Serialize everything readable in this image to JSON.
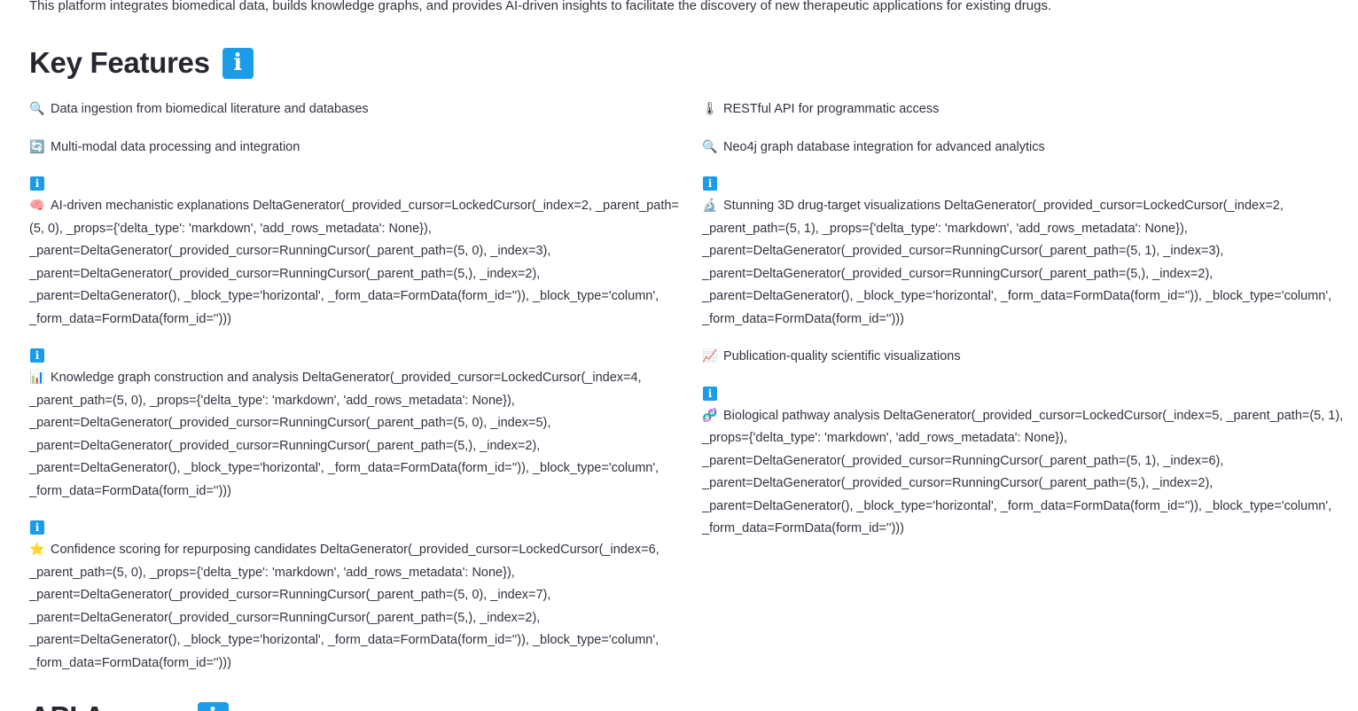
{
  "intro": "This platform integrates biomedical data, builds knowledge graphs, and provides AI-driven insights to facilitate the discovery of new therapeutic applications for existing drugs.",
  "key_features": {
    "title": "Key Features",
    "title_icon": "info-icon",
    "left": [
      {
        "emoji": "🔍",
        "icon": "magnifier-icon",
        "text": "Data ingestion from biomedical literature and databases"
      },
      {
        "emoji": "🔄",
        "icon": "refresh-icon",
        "text": "Multi-modal data processing and integration"
      },
      {
        "emoji": "🧠",
        "icon": "brain-icon",
        "info": true,
        "text": "AI-driven mechanistic explanations DeltaGenerator(_provided_cursor=LockedCursor(_index=2, _parent_path=(5, 0), _props={'delta_type': 'markdown', 'add_rows_metadata': None}), _parent=DeltaGenerator(_provided_cursor=RunningCursor(_parent_path=(5, 0), _index=3), _parent=DeltaGenerator(_provided_cursor=RunningCursor(_parent_path=(5,), _index=2), _parent=DeltaGenerator(), _block_type='horizontal', _form_data=FormData(form_id='')), _block_type='column', _form_data=FormData(form_id='')))"
      },
      {
        "emoji": "📊",
        "icon": "bar-chart-icon",
        "info": true,
        "text": "Knowledge graph construction and analysis DeltaGenerator(_provided_cursor=LockedCursor(_index=4, _parent_path=(5, 0), _props={'delta_type': 'markdown', 'add_rows_metadata': None}), _parent=DeltaGenerator(_provided_cursor=RunningCursor(_parent_path=(5, 0), _index=5), _parent=DeltaGenerator(_provided_cursor=RunningCursor(_parent_path=(5,), _index=2), _parent=DeltaGenerator(), _block_type='horizontal', _form_data=FormData(form_id='')), _block_type='column', _form_data=FormData(form_id='')))"
      },
      {
        "emoji": "⭐",
        "icon": "star-icon",
        "info": true,
        "text": "Confidence scoring for repurposing candidates DeltaGenerator(_provided_cursor=LockedCursor(_index=6, _parent_path=(5, 0), _props={'delta_type': 'markdown', 'add_rows_metadata': None}), _parent=DeltaGenerator(_provided_cursor=RunningCursor(_parent_path=(5, 0), _index=7), _parent=DeltaGenerator(_provided_cursor=RunningCursor(_parent_path=(5,), _index=2), _parent=DeltaGenerator(), _block_type='horizontal', _form_data=FormData(form_id='')), _block_type='column', _form_data=FormData(form_id='')))"
      }
    ],
    "right": [
      {
        "emoji": "🌡",
        "icon": "plug-icon",
        "text": "RESTful API for programmatic access"
      },
      {
        "emoji": "🔍",
        "icon": "magnifier-icon",
        "text": "Neo4j graph database integration for advanced analytics"
      },
      {
        "emoji": "🔬",
        "icon": "microscope-icon",
        "info": true,
        "text": "Stunning 3D drug-target visualizations DeltaGenerator(_provided_cursor=LockedCursor(_index=2, _parent_path=(5, 1), _props={'delta_type': 'markdown', 'add_rows_metadata': None}), _parent=DeltaGenerator(_provided_cursor=RunningCursor(_parent_path=(5, 1), _index=3), _parent=DeltaGenerator(_provided_cursor=RunningCursor(_parent_path=(5,), _index=2), _parent=DeltaGenerator(), _block_type='horizontal', _form_data=FormData(form_id='')), _block_type='column', _form_data=FormData(form_id='')))"
      },
      {
        "emoji": "📈",
        "icon": "line-chart-icon",
        "text": "Publication-quality scientific visualizations"
      },
      {
        "emoji": "🧬",
        "icon": "dna-icon",
        "info": true,
        "text": "Biological pathway analysis DeltaGenerator(_provided_cursor=LockedCursor(_index=5, _parent_path=(5, 1), _props={'delta_type': 'markdown', 'add_rows_metadata': None}), _parent=DeltaGenerator(_provided_cursor=RunningCursor(_parent_path=(5, 1), _index=6), _parent=DeltaGenerator(_provided_cursor=RunningCursor(_parent_path=(5,), _index=2), _parent=DeltaGenerator(), _block_type='horizontal', _form_data=FormData(form_id='')), _block_type='column', _form_data=FormData(form_id='')))"
      }
    ]
  },
  "next_section": {
    "title": "API Access",
    "title_icon": "info-icon"
  },
  "colors": {
    "info_badge": "#1a9ce8",
    "text": "#31333f",
    "heading": "#262730"
  }
}
